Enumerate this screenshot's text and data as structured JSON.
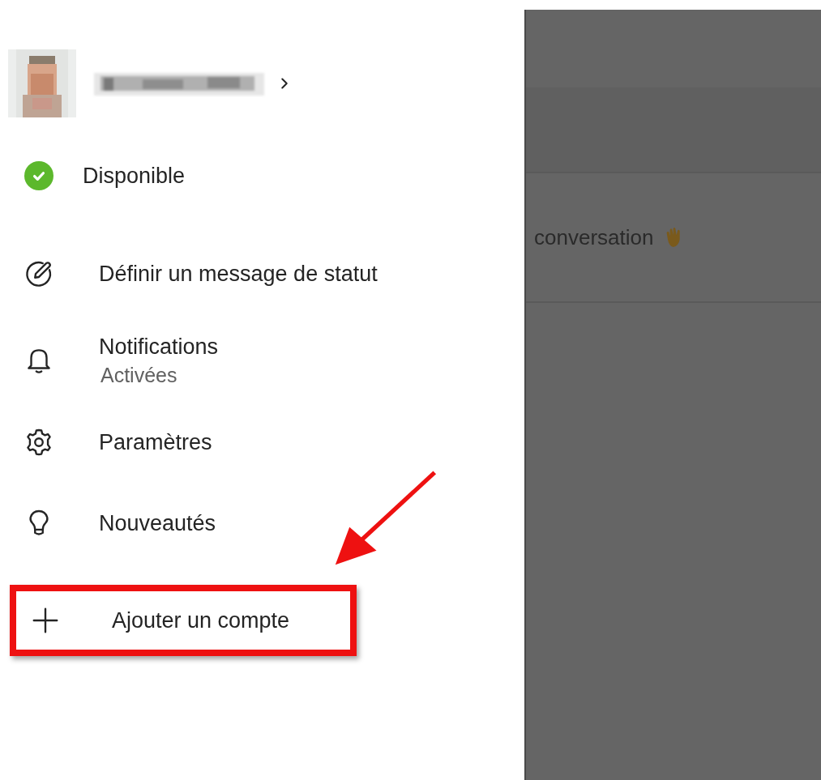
{
  "profile": {
    "name_hidden": true
  },
  "status": {
    "label": "Disponible",
    "color": "#5cb82c"
  },
  "menu": [
    {
      "kind": "status_message",
      "label": "Définir un message de statut",
      "highlighted": false
    },
    {
      "kind": "notifications",
      "label": "Notifications",
      "sublabel": "Activées",
      "highlighted": false
    },
    {
      "kind": "settings",
      "label": "Paramètres",
      "highlighted": false
    },
    {
      "kind": "whats_new",
      "label": "Nouveautés",
      "highlighted": false
    },
    {
      "kind": "add_account",
      "label": "Ajouter un compte",
      "highlighted": true
    }
  ],
  "background": {
    "preview_text": "conversation"
  }
}
